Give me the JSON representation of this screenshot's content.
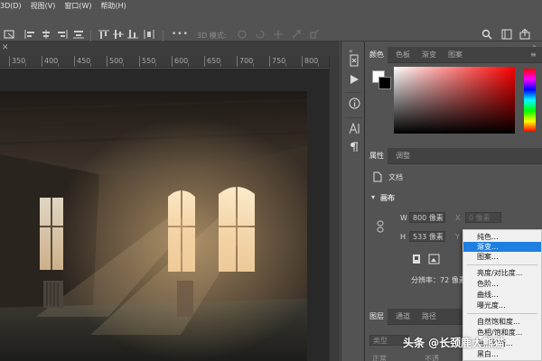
{
  "menubar": {
    "items": [
      "3D(D)",
      "视图(V)",
      "窗口(W)",
      "帮助(H)"
    ]
  },
  "options_bar": {
    "mode_3d_label": "3D 模式:",
    "more_label": "•••"
  },
  "ruler": {
    "labels": [
      "350",
      "400",
      "450",
      "500",
      "550",
      "600",
      "650",
      "700",
      "750",
      "800"
    ]
  },
  "color_panel": {
    "tabs": [
      "颜色",
      "色板",
      "渐变",
      "图案"
    ],
    "foreground_color": "#ffffff",
    "background_color": "#000000"
  },
  "properties_panel": {
    "tabs": [
      "属性",
      "调整"
    ],
    "doc_label": "文档",
    "section_title": "画布",
    "width_label": "W",
    "width_value": "800 像素",
    "height_label": "H",
    "height_value": "533 像素",
    "x_label": "X",
    "x_value": "0 像素",
    "y_label": "Y",
    "resolution": "分辨率：72 像素"
  },
  "layers_panel": {
    "tabs": [
      "图层",
      "通道",
      "路径"
    ],
    "search_placeholder": "类型",
    "mode_label": "正常",
    "opacity_label": "不透"
  },
  "adjustment_menu": {
    "items": [
      "纯色...",
      "渐变...",
      "图案...",
      "亮度/对比度...",
      "色阶...",
      "曲线...",
      "曝光度...",
      "自然饱和度...",
      "色相/饱和度...",
      "色彩平衡...",
      "黑白..."
    ],
    "selected": "渐变..."
  },
  "watermark": "头条 @长颈鹿大熊猫",
  "colors": {
    "accent": "#1e7fe0",
    "panel_bg": "#535353",
    "canvas_bg": "#282828"
  }
}
